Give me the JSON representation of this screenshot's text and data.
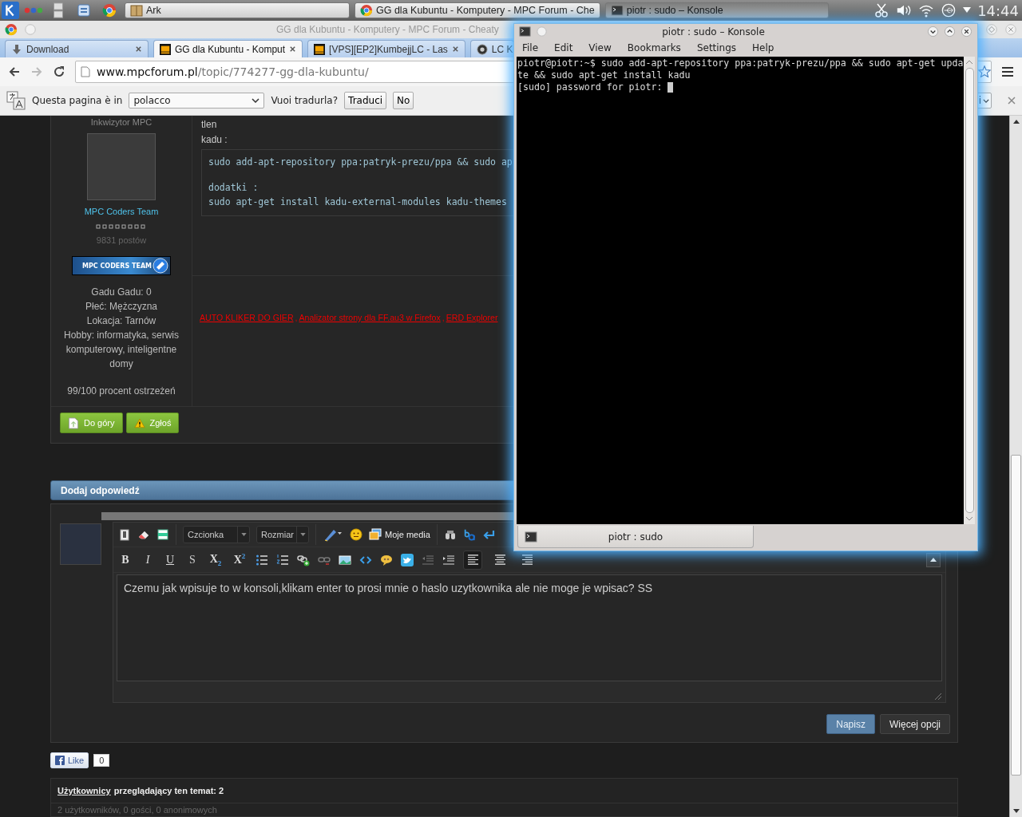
{
  "taskbar": {
    "tasks": [
      {
        "label": "Ark",
        "kind": "archive"
      },
      {
        "label": "GG dla Kubuntu - Komputery - MPC Forum - Che",
        "kind": "browser"
      },
      {
        "label": "piotr : sudo – Konsole",
        "kind": "terminal"
      }
    ],
    "clock": "14:44"
  },
  "browser": {
    "title": "GG dla Kubuntu - Komputery - MPC Forum - Cheaty",
    "tabs": [
      {
        "label": "Download",
        "selected": false,
        "kind": "download"
      },
      {
        "label": "GG dla Kubuntu - Komput",
        "selected": true,
        "kind": "site"
      },
      {
        "label": "[VPS][EP2]KumbejjLC - Las",
        "selected": false,
        "kind": "site"
      },
      {
        "label": "LC K",
        "selected": false,
        "kind": "globe"
      }
    ],
    "address": {
      "host": "www.mpcforum.pl",
      "path": "/topic/774277-gg-dla-kubuntu/"
    },
    "translate_bar": {
      "prompt": "Questa pagina è in",
      "language": "polacco",
      "question": "Vuoi tradurla?",
      "buttons": [
        "Traduci",
        "No"
      ],
      "options_label": "i"
    }
  },
  "post": {
    "author": {
      "title": "Inkwizytor MPC",
      "group": "MPC Coders Team",
      "posts": "9831 postów",
      "banner": "MPC CODERS TEAM",
      "fields": [
        "Gadu Gadu: 0",
        "Płeć: Mężczyzna",
        "Lokacja: Tarnów",
        "Hobby: informatyka, serwis komputerowy, inteligentne domy"
      ],
      "warnings": "99/100 procent ostrzeżeń"
    },
    "body": [
      "tlen",
      "kadu :"
    ],
    "code_blocks": [
      [
        "sudo add-apt-repository ppa:patryk-prezu/ppa && sudo ap"
      ],
      [
        "dodatki :",
        "sudo apt-get install kadu-external-modules kadu-themes"
      ]
    ],
    "signature": {
      "separator": ",",
      "links": [
        "AUTO KLIKER DO GIER",
        "Analizator strony dla FF.au3 w Firefox",
        "ERD Explorer"
      ]
    },
    "buttons": [
      {
        "label": "Do góry",
        "kind": "top"
      },
      {
        "label": "Zgłoś",
        "kind": "report"
      }
    ]
  },
  "reply": {
    "title": "Dodaj odpowiedź",
    "font_select": "Czcionka",
    "size_select": "Rozmiar",
    "media_button": "Moje media",
    "format_buttons": [
      {
        "kind": "bold",
        "label": "B"
      },
      {
        "kind": "italic",
        "label": "I"
      },
      {
        "kind": "underline",
        "label": "U"
      },
      {
        "kind": "strike",
        "label": "S"
      },
      {
        "kind": "sub",
        "label": "X$_{2}$"
      },
      {
        "kind": "sup",
        "label": "X$^{2}$"
      }
    ],
    "align_buttons": [
      {
        "kind": "left",
        "selected": true
      },
      {
        "kind": "center",
        "selected": false
      },
      {
        "kind": "right",
        "selected": false
      }
    ],
    "text": "Czemu jak wpisuje to w konsoli,klikam enter to prosi mnie o haslo uzytkownika ale nie moge je wpisac? SS",
    "buttons": [
      {
        "label": "Napisz",
        "kind": "primary"
      },
      {
        "label": "Więcej opcji",
        "kind": "secondary"
      }
    ]
  },
  "like": {
    "label": "Like",
    "count": "0"
  },
  "viewers": {
    "link": "Użytkownicy",
    "title": "przeglądający ten temat: 2",
    "summary": "2 użytkowników, 0 gości, 0 anonimowych"
  },
  "konsole": {
    "title": "piotr : sudo – Konsole",
    "menu": [
      "File",
      "Edit",
      "View",
      "Bookmarks",
      "Settings",
      "Help"
    ],
    "lines": [
      "piotr@piotr:~$ sudo add-apt-repository ppa:patryk-prezu/ppa && sudo apt-get upda",
      "te && sudo apt-get install kadu",
      "[sudo] password for piotr: "
    ],
    "tab": "piotr : sudo"
  }
}
